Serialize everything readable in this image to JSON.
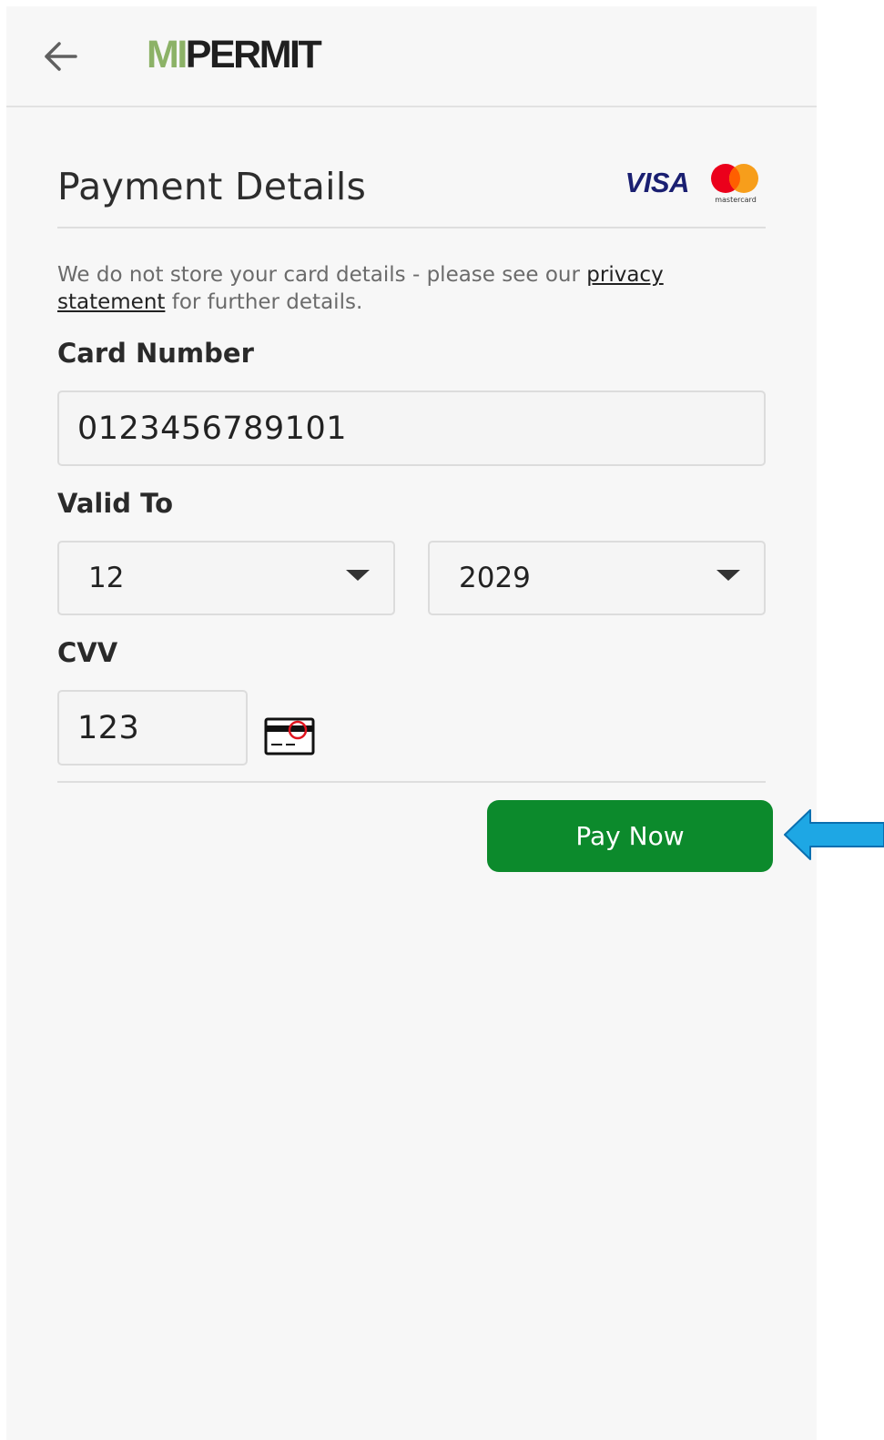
{
  "header": {
    "logo_mi": "MI",
    "logo_permit": "PERMIT"
  },
  "payment": {
    "title": "Payment Details",
    "card_brands": {
      "visa": "VISA",
      "mastercard": "mastercard"
    },
    "notice_text": "We do not store your card details - please see our ",
    "privacy_link": "privacy statement",
    "notice_tail": " for further details.",
    "card_number_label": "Card Number",
    "card_number_value": "0123456789101",
    "valid_to_label": "Valid To",
    "month_value": "12",
    "year_value": "2029",
    "cvv_label": "CVV",
    "cvv_value": "123",
    "pay_button": "Pay Now"
  },
  "icons": {
    "back": "arrow-left-icon",
    "cvv": "card-cvv-icon",
    "dropdown": "caret-down-icon",
    "callout": "blue-arrow-pointer"
  },
  "colors": {
    "brand_green": "#0c8a2c",
    "logo_mi": "#8cb267",
    "callout_arrow": "#1ea7e4",
    "visa_blue": "#1a1f71"
  }
}
